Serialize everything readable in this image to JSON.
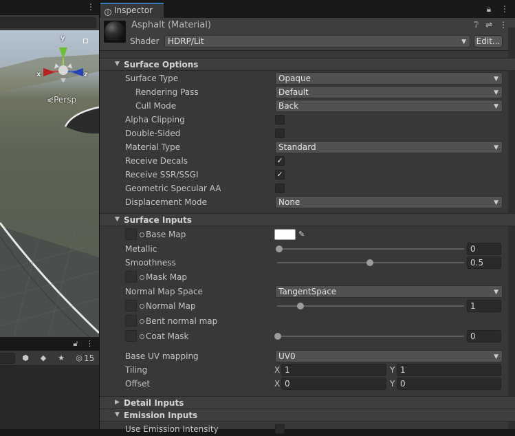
{
  "scene": {
    "persp_label": "Persp",
    "gizmo": {
      "x": "x",
      "y": "y",
      "z": "z"
    },
    "lower_toolbar": {
      "hidden_count": "15"
    }
  },
  "inspector": {
    "tab_label": "Inspector",
    "material_title": "Asphalt (Material)",
    "shader_label": "Shader",
    "shader_value": "HDRP/Lit",
    "edit_label": "Edit...",
    "sections": {
      "surface_options": "Surface Options",
      "surface_inputs": "Surface Inputs",
      "detail_inputs": "Detail Inputs",
      "emission_inputs": "Emission Inputs"
    },
    "surface_options": {
      "surface_type": {
        "label": "Surface Type",
        "value": "Opaque"
      },
      "rendering_pass": {
        "label": "Rendering Pass",
        "value": "Default"
      },
      "cull_mode": {
        "label": "Cull Mode",
        "value": "Back"
      },
      "alpha_clipping": {
        "label": "Alpha Clipping",
        "checked": false
      },
      "double_sided": {
        "label": "Double-Sided",
        "checked": false
      },
      "material_type": {
        "label": "Material Type",
        "value": "Standard"
      },
      "receive_decals": {
        "label": "Receive Decals",
        "checked": true
      },
      "receive_ssr": {
        "label": "Receive SSR/SSGI",
        "checked": true
      },
      "geometric_specular_aa": {
        "label": "Geometric Specular AA",
        "checked": false
      },
      "displacement_mode": {
        "label": "Displacement Mode",
        "value": "None"
      }
    },
    "surface_inputs": {
      "base_map": {
        "label": "Base Map",
        "color": "#ffffff"
      },
      "metallic": {
        "label": "Metallic",
        "value": "0",
        "fraction": 0.0
      },
      "smoothness": {
        "label": "Smoothness",
        "value": "0.5",
        "fraction": 0.5
      },
      "mask_map": {
        "label": "Mask Map"
      },
      "normal_map_space": {
        "label": "Normal Map Space",
        "value": "TangentSpace"
      },
      "normal_map": {
        "label": "Normal Map",
        "value": "1",
        "fraction": 0.125
      },
      "bent_normal_map": {
        "label": "Bent normal map"
      },
      "coat_mask": {
        "label": "Coat Mask",
        "value": "0",
        "fraction": 0.0
      },
      "base_uv_mapping": {
        "label": "Base UV mapping",
        "value": "UV0"
      },
      "tiling": {
        "label": "Tiling",
        "x_axis": "X",
        "x": "1",
        "y_axis": "Y",
        "y": "1"
      },
      "offset": {
        "label": "Offset",
        "x_axis": "X",
        "x": "0",
        "y_axis": "Y",
        "y": "0"
      }
    },
    "emission_inputs": {
      "use_emission_intensity": {
        "label": "Use Emission Intensity",
        "checked": false
      }
    }
  }
}
